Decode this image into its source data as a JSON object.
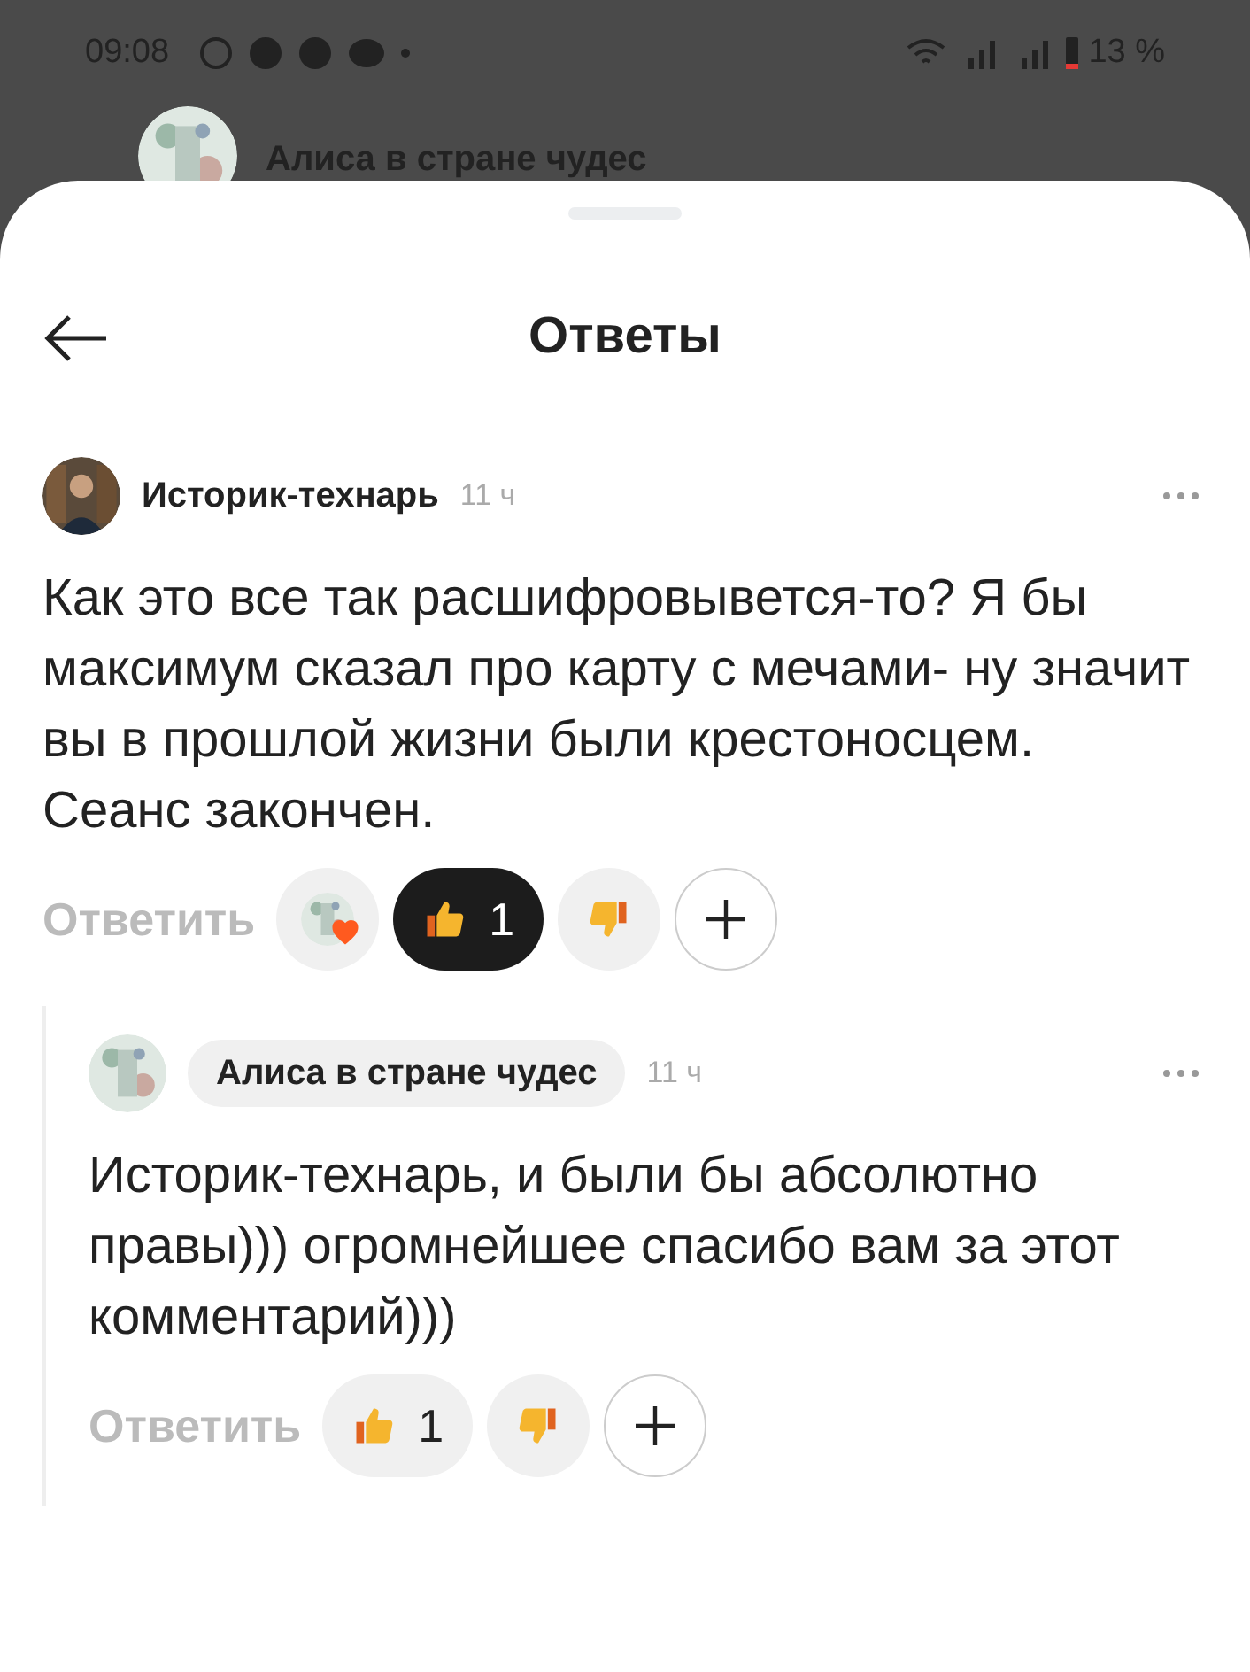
{
  "status_bar": {
    "time": "09:08",
    "battery": "13 %"
  },
  "background_header": {
    "title": "Алиса в стране чудес"
  },
  "sheet": {
    "title": "Ответы"
  },
  "comments": [
    {
      "author": "Историк-технарь",
      "author_highlighted": false,
      "time": "11 ч",
      "text": "Как это все так расшифровывется-то? Я бы максимум сказал про карту с мечами- ну значит вы в прошлой жизни были крестоносцем. Сеанс закончен.",
      "reply_label": "Ответить",
      "author_liked": true,
      "like_count": "1",
      "liked": true,
      "replies": [
        {
          "author": "Алиса в стране чудес",
          "author_highlighted": true,
          "time": "11 ч",
          "text": "Историк-технарь, и были бы абсолютно правы))) огромнейшее спасибо вам за этот комментарий)))",
          "reply_label": "Ответить",
          "author_liked": false,
          "like_count": "1",
          "liked": false
        }
      ]
    }
  ]
}
